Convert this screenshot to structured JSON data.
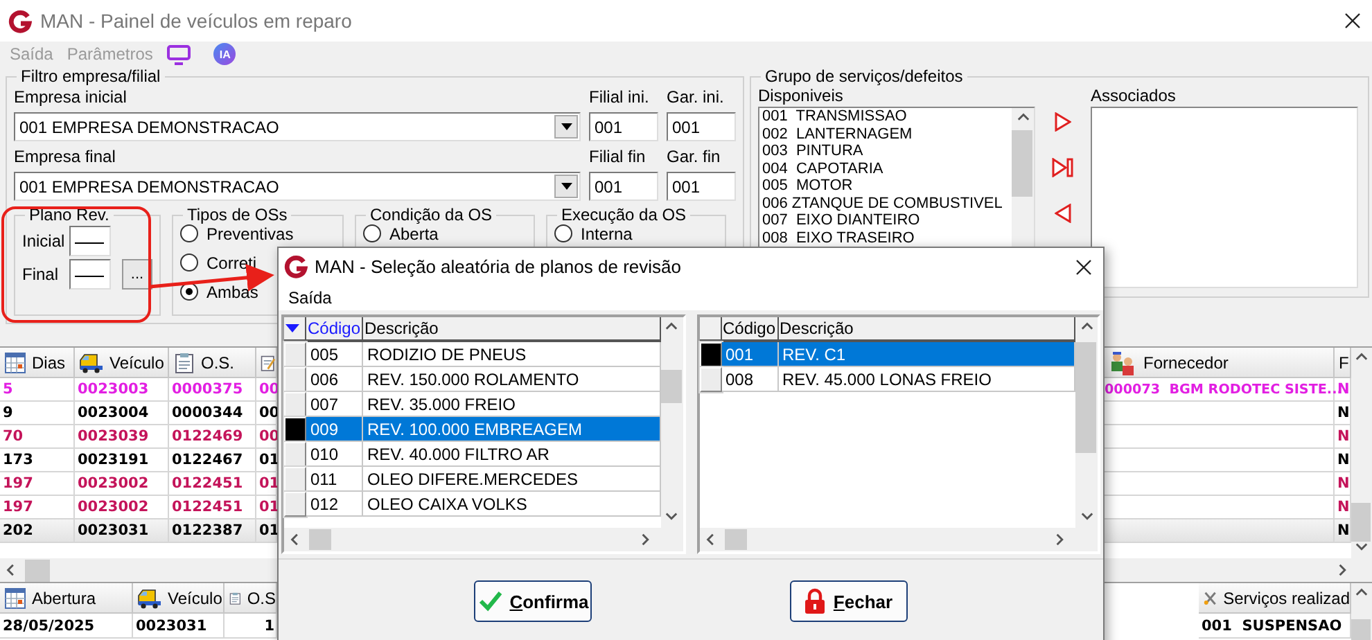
{
  "window": {
    "title": "MAN - Painel de veículos em reparo"
  },
  "menu": [
    "Saída",
    "Parâmetros"
  ],
  "ia_badge": "IA",
  "filter": {
    "title": "Filtro empresa/filial",
    "rows": [
      {
        "company_label": "Empresa inicial",
        "company": "001 EMPRESA DEMONSTRACAO",
        "branch_label": "Filial ini.",
        "branch": "001",
        "garage_label": "Gar. ini.",
        "garage": "001"
      },
      {
        "company_label": "Empresa final",
        "company": "001 EMPRESA DEMONSTRACAO",
        "branch_label": "Filial fin",
        "branch": "001",
        "garage_label": "Gar. fin",
        "garage": "001"
      }
    ]
  },
  "plan_group": {
    "title": "Plano Rev.",
    "fields": [
      "Inicial",
      "Final"
    ],
    "browse_button": "..."
  },
  "option_groups": [
    {
      "title": "Tipos de OSs",
      "options": [
        {
          "label": "Preventivas",
          "selected": false
        },
        {
          "label": "Correti",
          "selected": false
        },
        {
          "label": "Ambas",
          "selected": true
        }
      ]
    },
    {
      "title": "Condição da OS",
      "options": [
        {
          "label": "Aberta",
          "selected": false
        }
      ]
    },
    {
      "title": "Execução da OS",
      "options": [
        {
          "label": "Interna",
          "selected": false
        }
      ]
    }
  ],
  "service_group": {
    "title": "Grupo de serviços/defeitos",
    "available_label": "Disponiveis",
    "associated_label": "Associados",
    "available": [
      "001  TRANSMISSAO",
      "002  LANTERNAGEM",
      "003  PINTURA",
      "004  CAPOTARIA",
      "005  MOTOR",
      "006 ZTANQUE DE COMBUSTIVEL",
      "007  EIXO DIANTEIRO",
      "008  EIXO TRASEIRO"
    ]
  },
  "grid": {
    "columns": [
      {
        "kind": "calendar",
        "label": "Dias"
      },
      {
        "kind": "van",
        "label": "Veículo"
      },
      {
        "kind": "clipboard",
        "label": "O.S."
      },
      {
        "kind": "notepad"
      }
    ],
    "right_columns": [
      {
        "kind": "people",
        "label": "Fornecedor"
      },
      {
        "kind": "plain",
        "label": "F"
      }
    ],
    "rows": [
      {
        "color": "#e21fe2",
        "selected": false,
        "cells": [
          "5",
          "0023003",
          "0000375",
          "00"
        ],
        "supplier": "000073  BGM RODOTEC SISTE...",
        "flag": "N"
      },
      {
        "color": "#000000",
        "selected": false,
        "cells": [
          "9",
          "0023004",
          "0000344",
          "00"
        ],
        "flag": "N"
      },
      {
        "color": "#c4145a",
        "selected": false,
        "cells": [
          "70",
          "0023039",
          "0122469",
          "00"
        ],
        "flag": "N"
      },
      {
        "color": "#000000",
        "selected": false,
        "cells": [
          "173",
          "0023191",
          "0122467",
          "01"
        ],
        "flag": "N"
      },
      {
        "color": "#c4145a",
        "selected": false,
        "cells": [
          "197",
          "0023002",
          "0122451",
          "01"
        ],
        "flag": "N"
      },
      {
        "color": "#c4145a",
        "selected": false,
        "cells": [
          "197",
          "0023002",
          "0122451",
          "01"
        ],
        "flag": "N"
      },
      {
        "color": "#000000",
        "selected": true,
        "cells": [
          "202",
          "0023031",
          "0122387",
          "01"
        ],
        "flag": "N"
      }
    ]
  },
  "bottom_grid": {
    "columns": [
      {
        "kind": "calendar",
        "label": "Abertura"
      },
      {
        "kind": "van",
        "label": "Veículo"
      },
      {
        "kind": "clipboard",
        "label": "O.S"
      }
    ],
    "right_columns": [
      {
        "kind": "tools",
        "label": "Serviços realizad"
      }
    ],
    "rows": [
      {
        "cells": [
          "28/05/2025",
          "0023031",
          "1"
        ],
        "service": "001  SUSPENSAO"
      }
    ]
  },
  "dialog": {
    "title": "MAN - Seleção aleatória de planos de revisão",
    "menu": [
      "Saída"
    ],
    "grids": [
      {
        "sorted": true,
        "columns": [
          "Código",
          "Descrição"
        ],
        "rows": [
          {
            "code": "005",
            "description": "RODIZIO DE PNEUS",
            "selected": false
          },
          {
            "code": "006",
            "description": "REV. 150.000 ROLAMENTO",
            "selected": false
          },
          {
            "code": "007",
            "description": "REV. 35.000 FREIO",
            "selected": false
          },
          {
            "code": "009",
            "description": "REV. 100.000 EMBREAGEM",
            "selected": true
          },
          {
            "code": "010",
            "description": "REV. 40.000 FILTRO AR",
            "selected": false
          },
          {
            "code": "011",
            "description": "OLEO DIFERE.MERCEDES",
            "selected": false
          },
          {
            "code": "012",
            "description": "OLEO CAIXA VOLKS",
            "selected": false
          }
        ]
      },
      {
        "sorted": false,
        "columns": [
          "Código",
          "Descrição"
        ],
        "rows": [
          {
            "code": "001",
            "description": "REV. C1",
            "selected": true
          },
          {
            "code": "008",
            "description": "REV. 45.000 LONAS FREIO",
            "selected": false
          }
        ]
      }
    ],
    "buttons": [
      {
        "kind": "confirm",
        "label": "Confirma"
      },
      {
        "kind": "close",
        "label": "Fechar"
      }
    ]
  }
}
